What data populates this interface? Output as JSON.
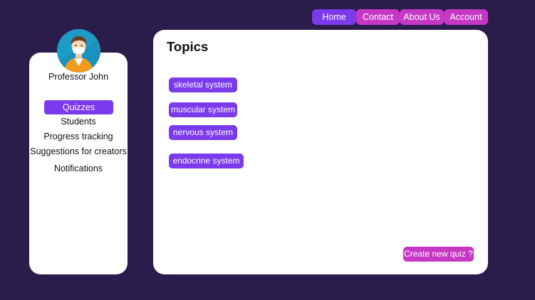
{
  "nav": {
    "home": "Home",
    "contact": "Contact",
    "about": "About Us",
    "account": "Account"
  },
  "sidebar": {
    "user_name": "Professor John",
    "avatar_icon": "teacher-avatar-icon",
    "items": [
      {
        "label": "Quizzes",
        "active": true
      },
      {
        "label": "Students",
        "active": false
      },
      {
        "label": "Progress tracking",
        "active": false
      },
      {
        "label": "Suggestions for creators",
        "active": false
      },
      {
        "label": "Notifications",
        "active": false
      }
    ]
  },
  "main": {
    "title": "Topics",
    "topics": [
      {
        "label": "skeletal system"
      },
      {
        "label": "muscular system"
      },
      {
        "label": "nervous system"
      },
      {
        "label": "endocrine system"
      }
    ],
    "create_button": "Create new quiz ?"
  },
  "colors": {
    "background": "#2b1d4b",
    "primary": "#7c3aed",
    "accent": "#c638c4",
    "panel": "#ffffff"
  }
}
